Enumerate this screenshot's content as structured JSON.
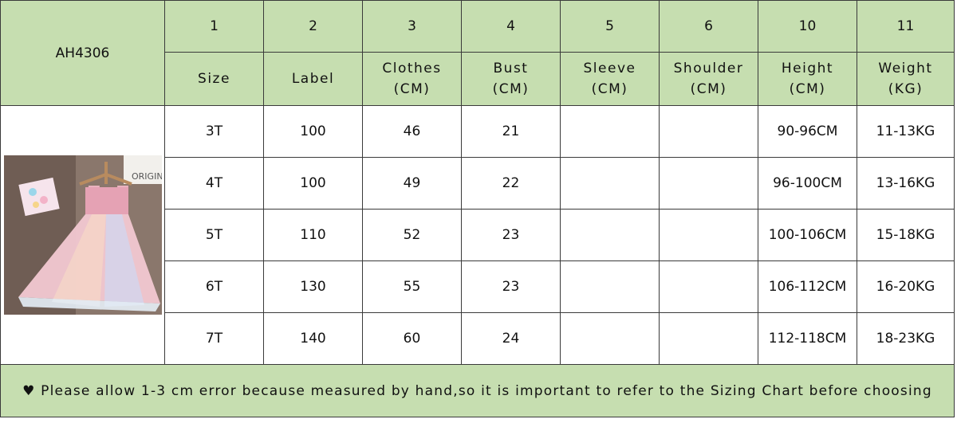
{
  "model": "AH4306",
  "header_numbers": [
    "1",
    "2",
    "3",
    "4",
    "5",
    "6",
    "10",
    "11"
  ],
  "header_labels": [
    {
      "line1": "Size",
      "line2": ""
    },
    {
      "line1": "Label",
      "line2": ""
    },
    {
      "line1": "Clothes",
      "line2": "(CM)"
    },
    {
      "line1": "Bust",
      "line2": "(CM)"
    },
    {
      "line1": "Sleeve",
      "line2": "(CM)"
    },
    {
      "line1": "Shoulder",
      "line2": "(CM)"
    },
    {
      "line1": "Height",
      "line2": "(CM)"
    },
    {
      "line1": "Weight",
      "line2": "(KG)"
    }
  ],
  "rows": [
    [
      "3T",
      "100",
      "46",
      "21",
      "",
      "",
      "90-96CM",
      "11-13KG"
    ],
    [
      "4T",
      "100",
      "49",
      "22",
      "",
      "",
      "96-100CM",
      "13-16KG"
    ],
    [
      "5T",
      "110",
      "52",
      "23",
      "",
      "",
      "100-106CM",
      "15-18KG"
    ],
    [
      "6T",
      "130",
      "55",
      "23",
      "",
      "",
      "106-112CM",
      "16-20KG"
    ],
    [
      "7T",
      "140",
      "60",
      "24",
      "",
      "",
      "112-118CM",
      "18-23KG"
    ]
  ],
  "photo_label": "ORIGINAL",
  "note": "♥ Please allow 1-3 cm error because measured by hand,so it is important to refer to the Sizing Chart before choosing",
  "colors": {
    "header_bg": "#c6deb0",
    "border": "#3a3a3a"
  }
}
